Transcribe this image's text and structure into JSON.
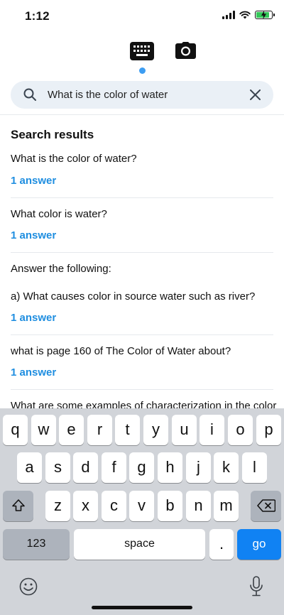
{
  "status": {
    "time": "1:12"
  },
  "search": {
    "query": "What is the color of water"
  },
  "results": {
    "title": "Search results",
    "items": [
      {
        "question": "What is the color of water?",
        "answers": "1 answer"
      },
      {
        "question": "What color is water?",
        "answers": "1 answer"
      },
      {
        "question": "Answer the following:",
        "question2": "a) What causes color in source water such as river?",
        "answers": "1 answer"
      },
      {
        "question": "what is page 160 of The Color of Water about?",
        "answers": "1 answer"
      },
      {
        "question": "What are some examples of characterization in the color"
      }
    ]
  },
  "keyboard": {
    "row1": [
      "q",
      "w",
      "e",
      "r",
      "t",
      "y",
      "u",
      "i",
      "o",
      "p"
    ],
    "row2": [
      "a",
      "s",
      "d",
      "f",
      "g",
      "h",
      "j",
      "k",
      "l"
    ],
    "row3": [
      "z",
      "x",
      "c",
      "v",
      "b",
      "n",
      "m"
    ],
    "numbers_label": "123",
    "space_label": "space",
    "period_label": ".",
    "go_label": "go"
  },
  "colors": {
    "accent": "#1f8ee0",
    "go_key": "#1082f3",
    "indicator": "#3d9df2"
  }
}
